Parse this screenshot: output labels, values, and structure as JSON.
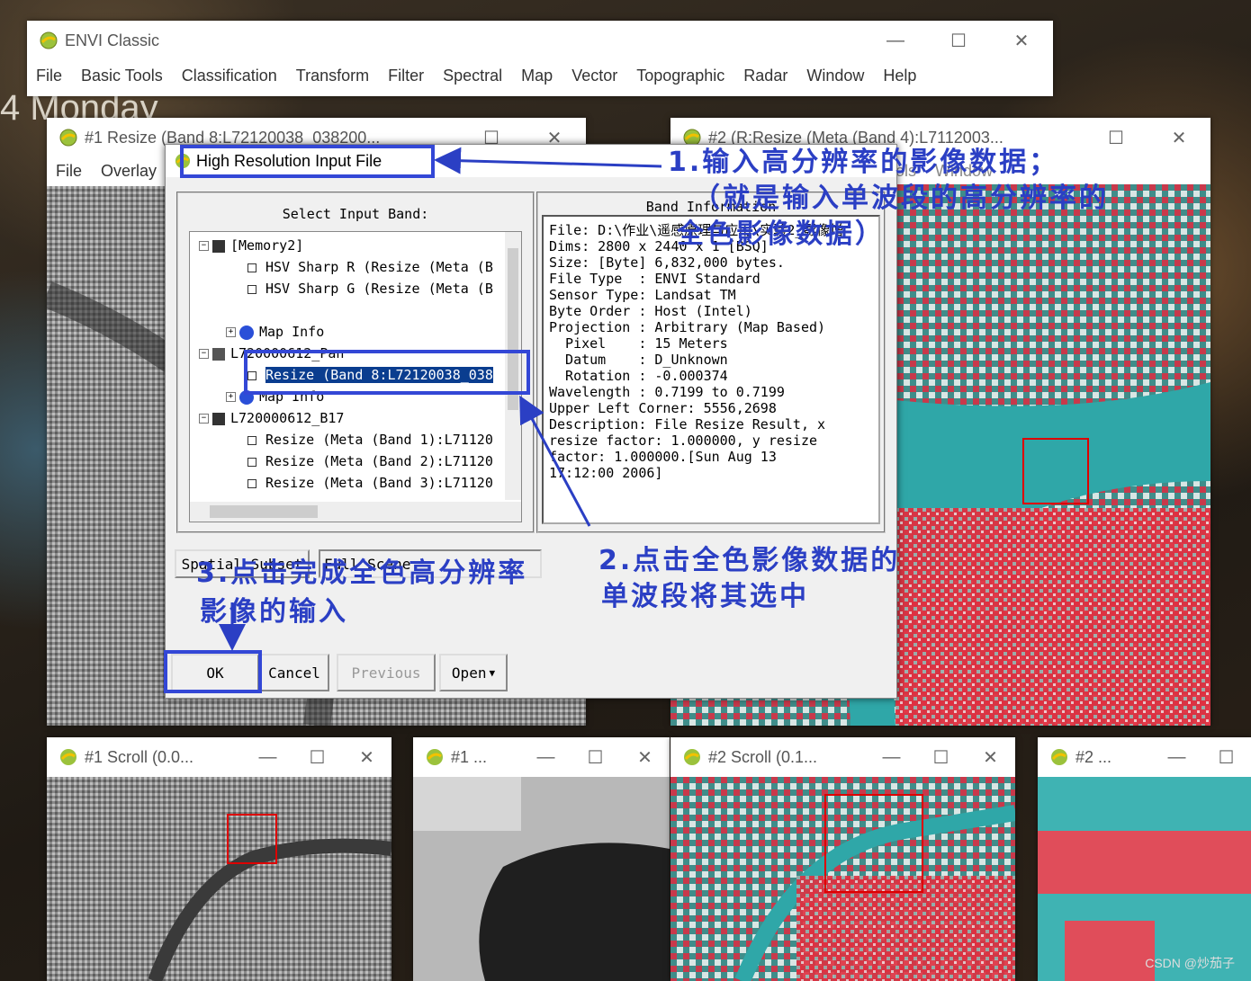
{
  "desktop": {
    "date_text": "4  Monday",
    "watermark": "CSDN @炒茄子"
  },
  "envi_main": {
    "title": "ENVI Classic",
    "menu": [
      "File",
      "Basic Tools",
      "Classification",
      "Transform",
      "Filter",
      "Spectral",
      "Map",
      "Vector",
      "Topographic",
      "Radar",
      "Window",
      "Help"
    ]
  },
  "image1": {
    "title": "#1 Resize (Band 8:L72120038_038200...",
    "menu": [
      "File",
      "Overlay"
    ]
  },
  "image2": {
    "title": "#2 (R:Resize (Meta (Band 4):L7112003...",
    "menu_partial": [
      "ools",
      "Window"
    ]
  },
  "dialog": {
    "title": "High Resolution Input File",
    "select_label": "Select Input Band:",
    "tree": [
      {
        "label": "[Memory2]",
        "level": 0,
        "type": "group"
      },
      {
        "label": "HSV Sharp R (Resize (Meta (B",
        "level": 1,
        "type": "band"
      },
      {
        "label": "HSV Sharp G (Resize (Meta (B",
        "level": 1,
        "type": "band"
      },
      {
        "label": "Map Info",
        "level": 1,
        "type": "map"
      },
      {
        "label": "L720000612_Pan",
        "level": 0,
        "type": "group"
      },
      {
        "label": "Resize (Band 8:L72120038_038",
        "level": 1,
        "type": "band",
        "selected": true
      },
      {
        "label": "Map Info",
        "level": 1,
        "type": "map"
      },
      {
        "label": "L720000612_B17",
        "level": 0,
        "type": "group"
      },
      {
        "label": "Resize (Meta (Band 1):L71120",
        "level": 1,
        "type": "band"
      },
      {
        "label": "Resize (Meta (Band 2):L71120",
        "level": 1,
        "type": "band"
      },
      {
        "label": "Resize (Meta (Band 3):L71120",
        "level": 1,
        "type": "band"
      }
    ],
    "band_info_label": "Band Information",
    "band_info": [
      "File: D:\\作业\\遥感原理与应用\\实验2_影像增",
      "Dims: 2800 x 2440 x 1 [BSQ]",
      "Size: [Byte] 6,832,000 bytes.",
      "File Type  : ENVI Standard",
      "Sensor Type: Landsat TM",
      "Byte Order : Host (Intel)",
      "Projection : Arbitrary (Map Based)",
      "  Pixel    : 15 Meters",
      "  Datum    : D_Unknown",
      "  Rotation : -0.000374",
      "Wavelength : 0.7199 to 0.7199",
      "Upper Left Corner: 5556,2698",
      "Description: File Resize Result, x",
      "resize factor: 1.000000, y resize",
      "factor: 1.000000.[Sun Aug 13",
      "17:12:00 2006]"
    ],
    "spatial_subset": "Spatial Subset",
    "full_scene": "Full Scene",
    "buttons": {
      "ok": "OK",
      "cancel": "Cancel",
      "previous": "Previous",
      "open": "Open"
    }
  },
  "annotations": {
    "a1_line1": "1.输入高分辨率的影像数据；",
    "a1_line2": "（就是输入单波段的高分辨率的",
    "a1_line3": "全色影像数据）",
    "a2_line1": "2.点击全色影像数据的",
    "a2_line2": "单波段将其选中",
    "a3_line1": "3.点击完成全色高分辨率",
    "a3_line2": "影像的输入"
  },
  "scroll_windows": [
    {
      "title": "#1 Scroll (0.0..."
    },
    {
      "title": "#1 ..."
    },
    {
      "title": "#2 Scroll (0.1..."
    },
    {
      "title": "#2 ..."
    }
  ],
  "colors": {
    "annotation": "#2b3fc4",
    "selection": "#0a3d8f",
    "river": "#2fa7a8",
    "vegetation": "#d8283a"
  }
}
